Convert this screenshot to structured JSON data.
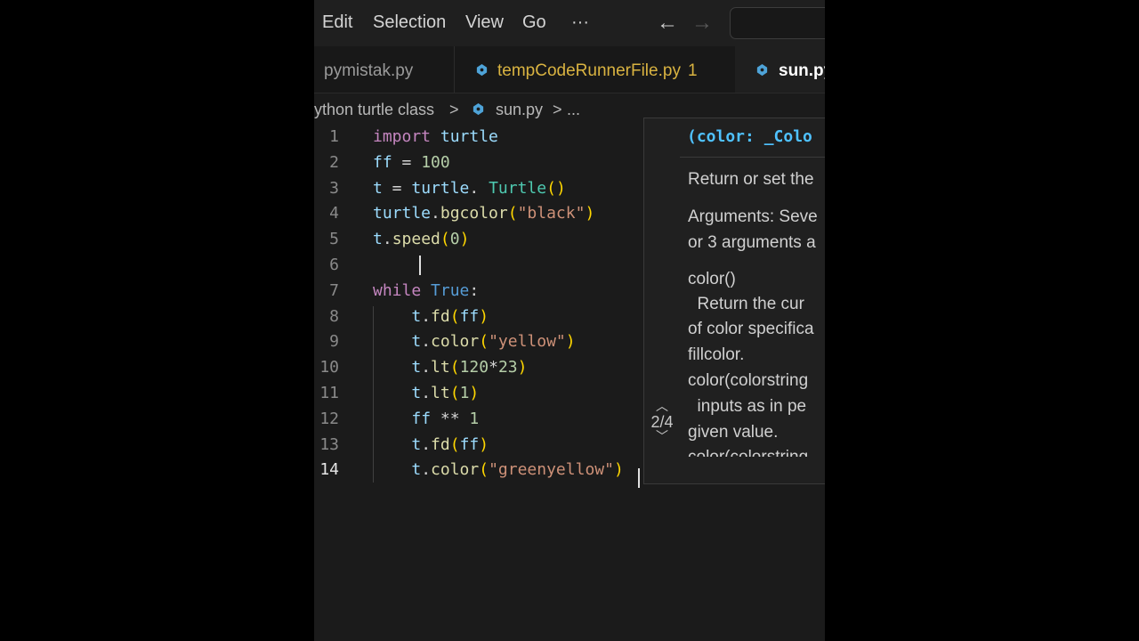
{
  "menu": {
    "edit": "Edit",
    "selection": "Selection",
    "view": "View",
    "go": "Go",
    "more": "···"
  },
  "nav": {
    "back_icon": "arrow-left",
    "forward_icon": "arrow-right"
  },
  "tabs": [
    {
      "label": "pymistak.py"
    },
    {
      "label": "tempCodeRunnerFile.py",
      "badge": "1"
    },
    {
      "label": "sun.py"
    }
  ],
  "breadcrumb": {
    "folder": "ython turtle class",
    "sep1": ">",
    "file": "sun.py",
    "sep2": ">",
    "more": "..."
  },
  "code": {
    "line_numbers": [
      "1",
      "2",
      "3",
      "4",
      "5",
      "6",
      "7",
      "8",
      "9",
      "10",
      "11",
      "12",
      "13",
      "14"
    ],
    "active_line": "14"
  },
  "hover": {
    "signature": "(color: _Colo",
    "desc": "Return or set the",
    "args1": "Arguments: Seve",
    "args2": "or 3 arguments a",
    "l1": "color()",
    "l2": "  Return the cur",
    "l3": "of color specifica",
    "l4": "fillcolor.",
    "l5": "color(colorstring",
    "l6": "  inputs as in pe",
    "l7": "given value.",
    "l8": "color(colorstring",
    "pager": "2/4"
  },
  "colors": {
    "keyword": "#c586c0",
    "function": "#dcdcaa",
    "string": "#ce9178",
    "variable": "#9cdcfe",
    "python_icon": "#4ea3d8"
  }
}
